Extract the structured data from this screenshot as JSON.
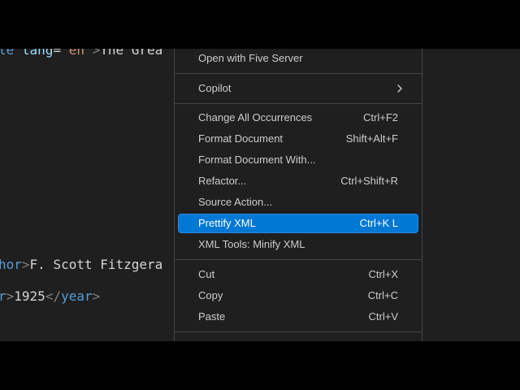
{
  "editor": {
    "line1": {
      "tag": "le",
      "attr": "lang",
      "eq": "=",
      "value": "\"en\"",
      "close": ">",
      "text": "The Grea"
    },
    "line2": {
      "tag": "hor",
      "close": ">",
      "text": "F. Scott Fitzgera"
    },
    "line3": {
      "tag": "r",
      "close": ">",
      "text": "1925",
      "end_open": "</",
      "end_tag": "year",
      "end_close": ">"
    }
  },
  "context_menu": {
    "items": [
      {
        "label": "Open with Five Server",
        "shortcut": ""
      },
      {
        "label": "Copilot",
        "shortcut": "",
        "submenu_icon": "chevron-right-icon"
      },
      {
        "label": "Change All Occurrences",
        "shortcut": "Ctrl+F2"
      },
      {
        "label": "Format Document",
        "shortcut": "Shift+Alt+F"
      },
      {
        "label": "Format Document With...",
        "shortcut": ""
      },
      {
        "label": "Refactor...",
        "shortcut": "Ctrl+Shift+R"
      },
      {
        "label": "Source Action...",
        "shortcut": ""
      },
      {
        "label": "Prettify XML",
        "shortcut": "Ctrl+K L",
        "selected": true
      },
      {
        "label": "XML Tools: Minify XML",
        "shortcut": ""
      },
      {
        "label": "Cut",
        "shortcut": "Ctrl+X"
      },
      {
        "label": "Copy",
        "shortcut": "Ctrl+C"
      },
      {
        "label": "Paste",
        "shortcut": "Ctrl+V"
      }
    ]
  },
  "colors": {
    "editor_bg": "#1f1f1f",
    "menu_bg": "#1f1f1f",
    "selection": "#0078d4",
    "tag": "#569cd6",
    "attribute": "#9cdcfe",
    "string": "#ce9178",
    "text": "#d4d4d4"
  }
}
